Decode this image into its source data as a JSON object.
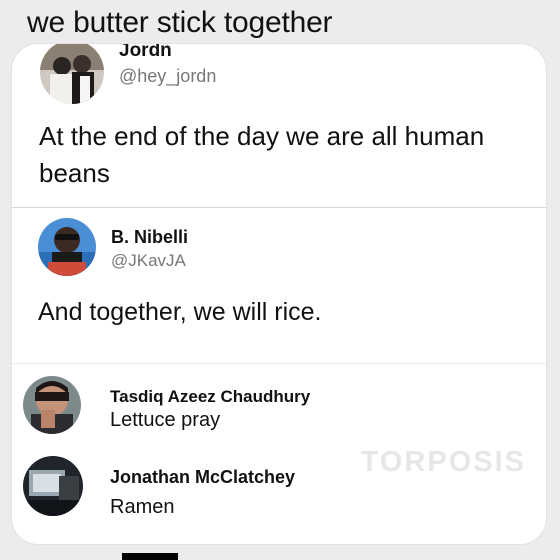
{
  "caption": "we butter stick together",
  "tweet1": {
    "name": "Jordn",
    "handle": "@hey_jordn",
    "text": "At the end of the day we are all human beans"
  },
  "tweet2": {
    "name": "B. Nibelli",
    "handle": "@JKavJA",
    "text": "And together, we will rice."
  },
  "replies": [
    {
      "name": "Tasdiq Azeez Chaudhury",
      "text": "Lettuce pray"
    },
    {
      "name": "Jonathan McClatchey",
      "text": "Ramen"
    }
  ],
  "watermark": "TORPOSIS"
}
